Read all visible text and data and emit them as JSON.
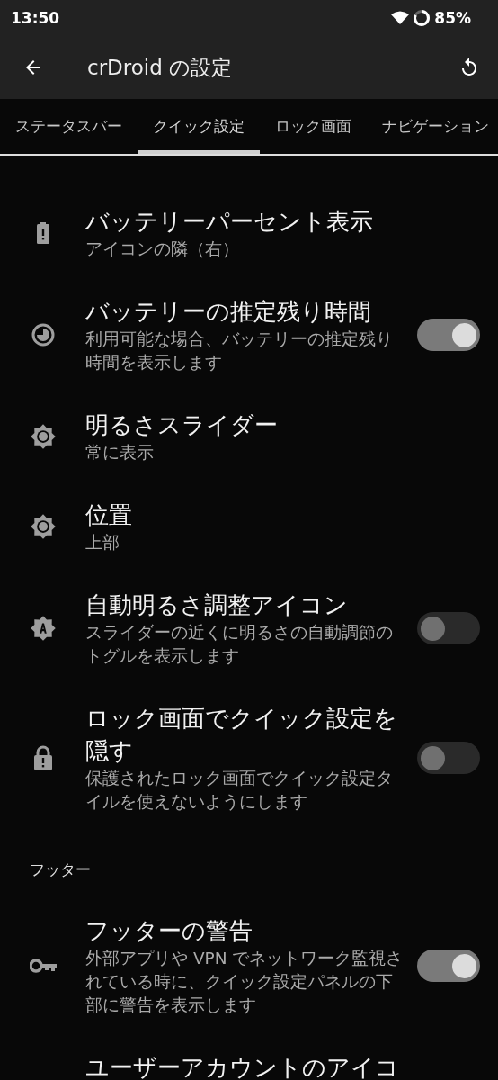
{
  "status_bar": {
    "time": "13:50",
    "battery": "85%"
  },
  "app_bar": {
    "title": "crDroid の設定"
  },
  "tabs": [
    {
      "label": "ステータスバー",
      "selected": false
    },
    {
      "label": "クイック設定",
      "selected": true
    },
    {
      "label": "ロック画面",
      "selected": false
    },
    {
      "label": "ナビゲーション",
      "selected": false
    }
  ],
  "sections": [
    {
      "items": [
        {
          "kind": "plain",
          "title": "バッテリーパーセント表示",
          "summary": "アイコンの隣（右）"
        },
        {
          "kind": "toggle",
          "title": "バッテリーの推定残り時間",
          "summary": "利用可能な場合、バッテリーの推定残り時間を表示します",
          "on": true
        },
        {
          "kind": "plain",
          "title": "明るさスライダー",
          "summary": "常に表示"
        },
        {
          "kind": "plain",
          "title": "位置",
          "summary": "上部"
        },
        {
          "kind": "toggle",
          "title": "自動明るさ調整アイコン",
          "summary": "スライダーの近くに明るさの自動調節のトグルを表示します",
          "on": false
        },
        {
          "kind": "toggle",
          "title": "ロック画面でクイック設定を隠す",
          "summary": "保護されたロック画面でクイック設定タイルを使えないようにします",
          "on": false
        }
      ]
    },
    {
      "header": "フッター",
      "items": [
        {
          "kind": "toggle",
          "title": "フッターの警告",
          "summary": "外部アプリや VPN でネットワーク監視されている時に、クイック設定パネルの下部に警告を表示します",
          "on": true
        },
        {
          "kind": "plain",
          "title": "ユーザーアカウントのアイコ"
        }
      ]
    }
  ]
}
